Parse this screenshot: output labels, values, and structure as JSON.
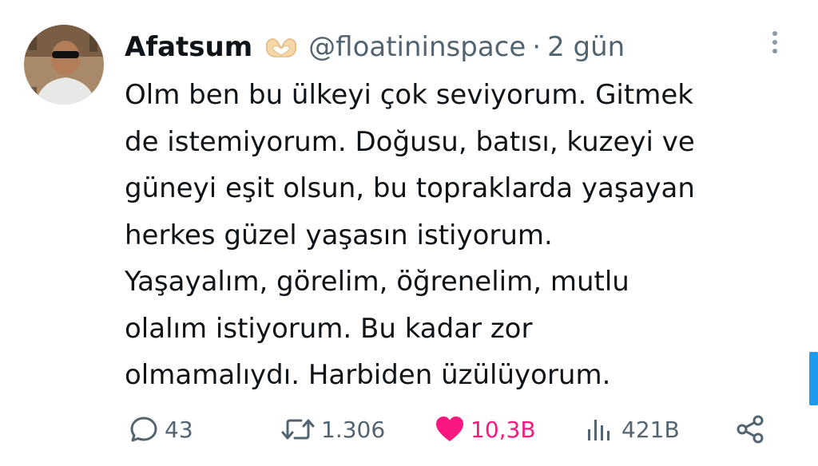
{
  "tweet": {
    "display_name": "Afatsum",
    "name_emoji": "heart-hands-emoji",
    "handle": "@floatininspace",
    "separator": "·",
    "time": "2 gün",
    "text": "Olm ben bu ülkeyi çok seviyorum. Gitmek\nde istemiyorum. Doğusu, batısı, kuzeyi ve\ngüneyi eşit olsun, bu topraklarda yaşayan\nherkes güzel yaşasın istiyorum.\nYaşayalım, görelim, öğrenelim, mutlu\nolalım istiyorum. Bu kadar zor\nolmamalıydı. Harbiden üzülüyorum."
  },
  "actions": {
    "replies": "43",
    "retweets": "1.306",
    "likes": "10,3B",
    "views": "421B"
  },
  "icons": {
    "reply": "speech-bubble-icon",
    "retweet": "retweet-arrows-icon",
    "like": "heart-icon",
    "views": "bar-chart-icon",
    "share": "share-nodes-icon",
    "more": "vertical-dots-icon"
  },
  "colors": {
    "text": "#0f1419",
    "secondary": "#536471",
    "like_active": "#f91880",
    "scrollbar": "#1d9bf0"
  }
}
